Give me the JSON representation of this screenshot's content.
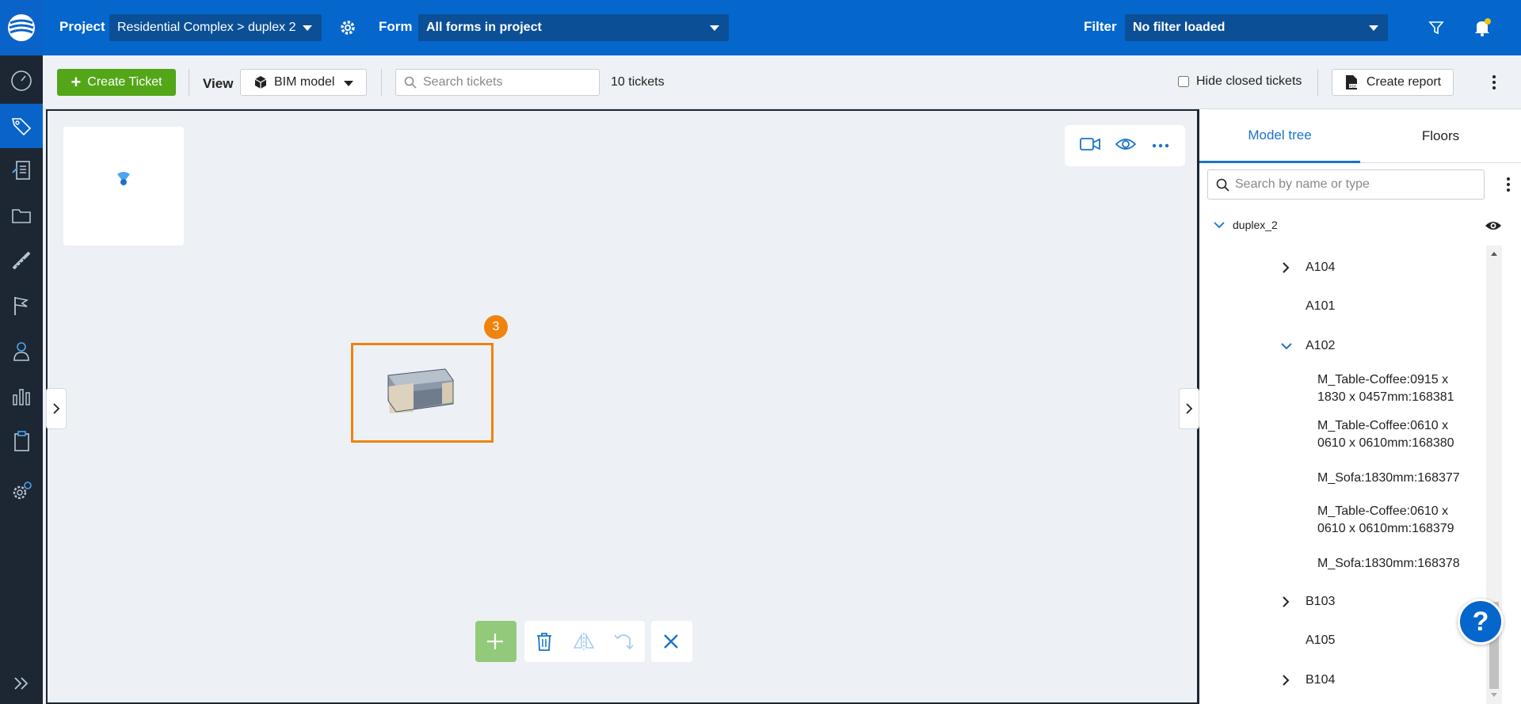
{
  "header": {
    "project_label": "Project",
    "project_value": "Residential Complex > duplex 2",
    "form_label": "Form",
    "form_value": "All forms in project",
    "filter_label": "Filter",
    "filter_value": "No filter loaded"
  },
  "toolbar": {
    "create_ticket": "Create Ticket",
    "view_label": "View",
    "view_value": "BIM model",
    "search_placeholder": "Search tickets",
    "ticket_count": "10 tickets",
    "hide_closed": "Hide closed tickets",
    "create_report": "Create report"
  },
  "viewer": {
    "badge_count": "3"
  },
  "panel": {
    "tabs": [
      "Model tree",
      "Floors"
    ],
    "search_placeholder": "Search by name or type",
    "root": "duplex_2",
    "items": [
      {
        "label": "A104",
        "expand": "collapsed"
      },
      {
        "label": "A101",
        "expand": "none"
      },
      {
        "label": "A102",
        "expand": "expanded"
      },
      {
        "label": "M_Table-Coffee:0915 x 1830 x 0457mm:168381",
        "expand": "leaf"
      },
      {
        "label": "M_Table-Coffee:0610 x 0610 x 0610mm:168380",
        "expand": "leaf"
      },
      {
        "label": "M_Sofa:1830mm:168377",
        "expand": "leaf"
      },
      {
        "label": "M_Table-Coffee:0610 x 0610 x 0610mm:168379",
        "expand": "leaf"
      },
      {
        "label": "M_Sofa:1830mm:168378",
        "expand": "leaf"
      },
      {
        "label": "B103",
        "expand": "collapsed"
      },
      {
        "label": "A105",
        "expand": "none"
      },
      {
        "label": "B104",
        "expand": "collapsed"
      }
    ]
  },
  "help": {
    "label": "?"
  },
  "colors": {
    "brand_blue": "#0566cc",
    "rail_dark": "#1d2733",
    "create_green": "#53a618",
    "selection_orange": "#f0830d",
    "active_tab": "#1a73c8"
  }
}
